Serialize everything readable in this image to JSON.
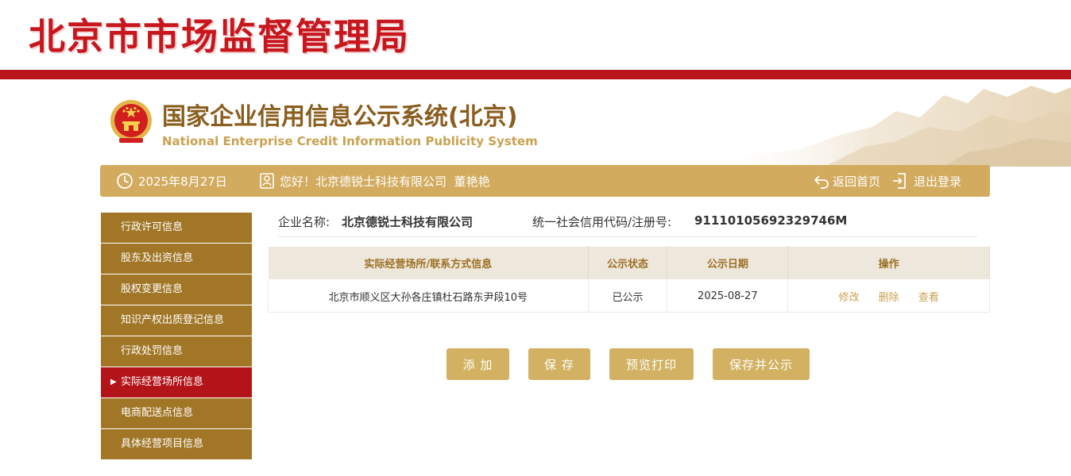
{
  "header": {
    "bureau_title": "北京市市场监督管理局"
  },
  "system": {
    "title_cn": "国家企业信用信息公示系统(北京)",
    "title_en": "National Enterprise Credit Information Publicity System"
  },
  "info_bar": {
    "date": "2025年8月27日",
    "greeting": "您好！北京德锐士科技有限公司  董艳艳",
    "home_label": "返回首页",
    "logout_label": "退出登录",
    "bar_color": "#d2ab5e"
  },
  "sidebar": {
    "items": [
      {
        "label": "行政许可信息",
        "active": false
      },
      {
        "label": "股东及出资信息",
        "active": false
      },
      {
        "label": "股权变更信息",
        "active": false
      },
      {
        "label": "知识产权出质登记信息",
        "active": false
      },
      {
        "label": "行政处罚信息",
        "active": false
      },
      {
        "label": "实际经营场所信息",
        "active": true
      },
      {
        "label": "电商配送点信息",
        "active": false
      },
      {
        "label": "具体经营项目信息",
        "active": false
      }
    ],
    "item_color": "#a17727",
    "active_color": "#b3141a"
  },
  "company": {
    "name_label": "企业名称:",
    "name": "北京德锐士科技有限公司",
    "code_label": "统一社会信用代码/注册号:",
    "code": "91110105692329746M"
  },
  "table": {
    "headers": [
      "实际经营场所/联系方式信息",
      "公示状态",
      "公示日期",
      "操作"
    ],
    "rows": [
      {
        "address": "北京市顺义区大孙各庄镇杜石路东尹段10号",
        "status": "已公示",
        "date": "2025-08-27",
        "ops": [
          "修改",
          "删除",
          "查看"
        ]
      }
    ]
  },
  "buttons": {
    "add": "添 加",
    "save": "保 存",
    "preview_print": "预览打印",
    "save_publish": "保存并公示"
  },
  "colors": {
    "brand_red": "#c8161d",
    "gold": "#d2b262"
  }
}
